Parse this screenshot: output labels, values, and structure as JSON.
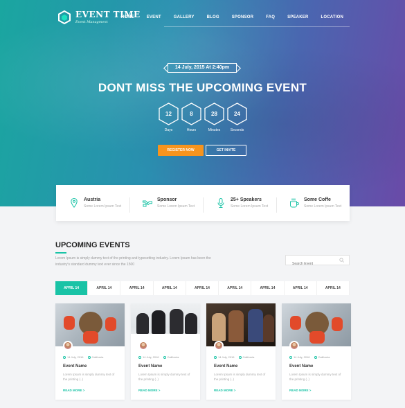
{
  "brand": {
    "title": "EVENT TIME",
    "subtitle": "Event Managment"
  },
  "nav": [
    "HOME",
    "EVENT",
    "GALLERY",
    "BLOG",
    "SPONSOR",
    "FAQ",
    "SPEAKER",
    "LOCATION"
  ],
  "hero": {
    "date": "14 July, 2015 At 2:40pm",
    "headline": "DONT MISS THE UPCOMING EVENT",
    "counters": [
      {
        "value": "12",
        "label": "Days"
      },
      {
        "value": "8",
        "label": "Hours"
      },
      {
        "value": "28",
        "label": "Minutes"
      },
      {
        "value": "24",
        "label": "Seconds"
      }
    ],
    "register_label": "REGISTER NOW",
    "invite_label": "GET INVITE"
  },
  "info": [
    {
      "icon": "map-pin-icon",
      "title": "Austria",
      "text": "Some Lorem Ipsum Text"
    },
    {
      "icon": "handshake-icon",
      "title": "Sponsor",
      "text": "Some Lorem Ipsum Text"
    },
    {
      "icon": "microphone-icon",
      "title": "25+ Speakers",
      "text": "Some Lorem Ipsum Text"
    },
    {
      "icon": "coffee-icon",
      "title": "Some Coffe",
      "text": "Some Lorem Ipsum Text"
    }
  ],
  "upcoming": {
    "title": "UPCOMING EVENTS",
    "desc": "Lorem Ipsum is simply dummy text of the printing and typesetting industry. Lorem Ipsum has been the industry's standard dummy text ever since the 1500",
    "search_placeholder": "Search Event"
  },
  "tabs": [
    "APRIL 14",
    "APRIL 14",
    "APRIL 14",
    "APRIL 14",
    "APRIL 14",
    "APRIL 14",
    "APRIL 14",
    "APRIL 14",
    "APRIL 14"
  ],
  "cards": [
    {
      "date": "14 July, 2016",
      "location": "California",
      "name": "Event Name",
      "desc": "Lorem Ipsum is simply dummy text of the printing (..)",
      "more": "READ MORE >"
    },
    {
      "date": "14 July, 2016",
      "location": "California",
      "name": "Event Name",
      "desc": "Lorem Ipsum is simply dummy text of the printing (..)",
      "more": "READ MORE >"
    },
    {
      "date": "14 July, 2016",
      "location": "California",
      "name": "Event Name",
      "desc": "Lorem Ipsum is simply dummy text of the printing (..)",
      "more": "READ MORE >"
    },
    {
      "date": "14 July, 2016",
      "location": "California",
      "name": "Event Name",
      "desc": "Lorem Ipsum is simply dummy text of the printing (..)",
      "more": "READ MORE >"
    }
  ],
  "colors": {
    "accent": "#19c3a6",
    "register": "#f7941d"
  }
}
